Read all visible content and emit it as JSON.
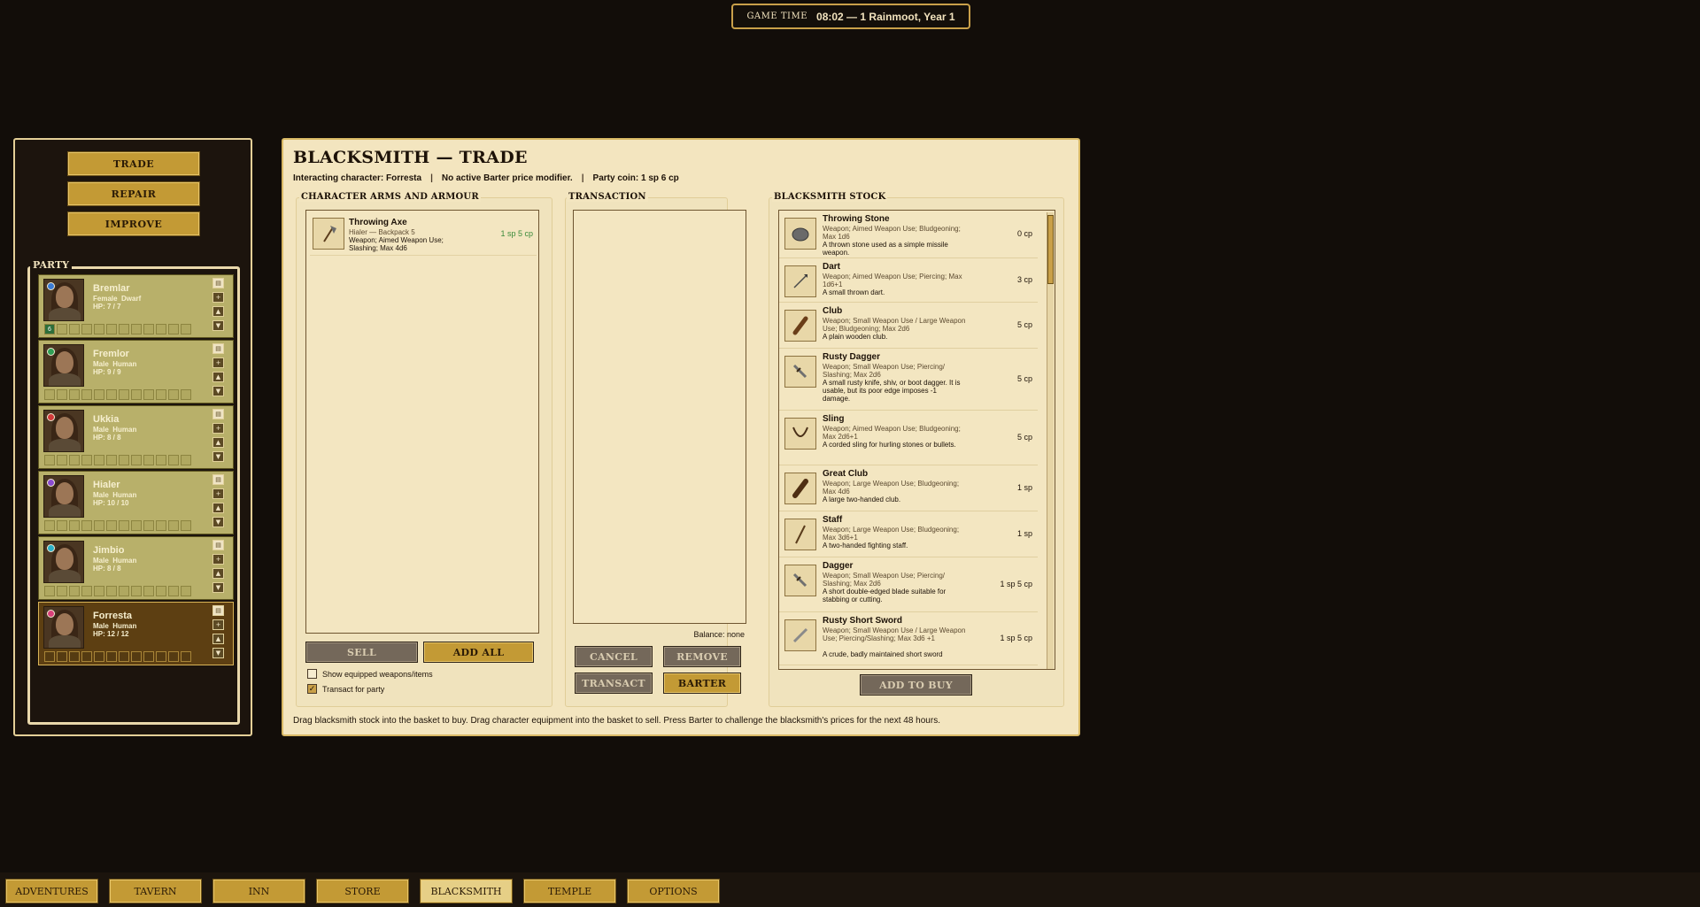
{
  "game_time": {
    "label": "GAME TIME",
    "value": "08:02 — 1 Rainmoot, Year 1"
  },
  "side_actions": [
    "TRADE",
    "REPAIR",
    "IMPROVE"
  ],
  "party": {
    "label": "PARTY",
    "members": [
      {
        "name": "Bremlar",
        "gender": "Female",
        "race": "Dwarf",
        "hp": "HP:  7 / 7",
        "dot": "#3a7bd5",
        "badge": "6",
        "selected": false
      },
      {
        "name": "Fremlor",
        "gender": "Male",
        "race": "Human",
        "hp": "HP:  9 / 9",
        "dot": "#2f9e55",
        "badge": "",
        "selected": false
      },
      {
        "name": "Ukkia",
        "gender": "Male",
        "race": "Human",
        "hp": "HP:  8 / 8",
        "dot": "#d03a3a",
        "badge": "",
        "selected": false
      },
      {
        "name": "Hialer",
        "gender": "Male",
        "race": "Human",
        "hp": "HP:  10 / 10",
        "dot": "#8a4bd0",
        "badge": "",
        "selected": false
      },
      {
        "name": "Jimbio",
        "gender": "Male",
        "race": "Human",
        "hp": "HP:  8 / 8",
        "dot": "#2ab0c8",
        "badge": "",
        "selected": false
      },
      {
        "name": "Forresta",
        "gender": "Male",
        "race": "Human",
        "hp": "HP:  12 / 12",
        "dot": "#d8407a",
        "badge": "",
        "selected": true
      }
    ]
  },
  "main": {
    "title": "BLACKSMITH — TRADE",
    "interacting": "Interacting character: Forresta",
    "barter_status": "No active Barter price modifier.",
    "party_coin": "Party coin: 1 sp 6 cp",
    "footer": "Drag blacksmith stock into the basket to buy. Drag character equipment into the basket to sell. Press Barter to challenge the blacksmith's prices for the next 48 hours."
  },
  "character": {
    "heading": "CHARACTER ARMS AND ARMOUR",
    "items": [
      {
        "name": "Throwing Axe",
        "owner": "Hialer — Backpack 5",
        "type": "Weapon; Aimed Weapon Use; Slashing; Max 4d6",
        "price": "1 sp 5 cp",
        "icon": "axe-icon"
      }
    ],
    "sell_label": "SELL",
    "add_all_label": "ADD ALL",
    "show_equipped_label": "Show equipped weapons/items",
    "transact_party_label": "Transact for party"
  },
  "transaction": {
    "heading": "TRANSACTION",
    "balance": "Balance: none",
    "cancel_label": "CANCEL",
    "remove_label": "REMOVE",
    "transact_label": "TRANSACT",
    "barter_label": "BARTER"
  },
  "stock": {
    "heading": "BLACKSMITH STOCK",
    "add_to_buy_label": "ADD TO BUY",
    "items": [
      {
        "name": "Throwing Stone",
        "type": "Weapon; Aimed Weapon Use; Bludgeoning; Max 1d6",
        "desc": "A thrown stone used as a simple missile weapon.",
        "price": "0 cp",
        "icon": "stone-icon"
      },
      {
        "name": "Dart",
        "type": "Weapon; Aimed Weapon Use; Piercing; Max 1d6+1",
        "desc": "A small thrown dart.",
        "price": "3 cp",
        "icon": "dart-icon"
      },
      {
        "name": "Club",
        "type": "Weapon; Small Weapon Use / Large Weapon Use; Bludgeoning; Max 2d6",
        "desc": "A plain wooden club.",
        "price": "5 cp",
        "icon": "club-icon"
      },
      {
        "name": "Rusty Dagger",
        "type": "Weapon; Small Weapon Use; Piercing/ Slashing; Max 2d6",
        "desc": "A small rusty knife, shiv, or boot dagger. It is usable, but its poor edge imposes -1 damage.",
        "price": "5 cp",
        "icon": "dagger-icon"
      },
      {
        "name": "Sling",
        "type": "Weapon; Aimed Weapon Use; Bludgeoning; Max 2d6+1",
        "desc": "A corded sling for hurling stones or bullets.",
        "price": "5 cp",
        "icon": "sling-icon"
      },
      {
        "name": "Great Club",
        "type": "Weapon; Large Weapon Use; Bludgeoning; Max 4d6",
        "desc": "A large two-handed club.",
        "price": "1 sp",
        "icon": "great-club-icon"
      },
      {
        "name": "Staff",
        "type": "Weapon; Large Weapon Use; Bludgeoning; Max 3d6+1",
        "desc": "A two-handed fighting staff.",
        "price": "1 sp",
        "icon": "staff-icon"
      },
      {
        "name": "Dagger",
        "type": "Weapon; Small Weapon Use; Piercing/ Slashing; Max 2d6",
        "desc": "A short double-edged blade suitable for stabbing or cutting.",
        "price": "1 sp 5 cp",
        "icon": "dagger-icon"
      },
      {
        "name": "Rusty Short Sword",
        "type": "Weapon; Small Weapon Use / Large Weapon Use; Piercing/Slashing; Max 3d6 +1",
        "desc": "A crude, badly maintained short sword",
        "price": "1 sp 5 cp",
        "icon": "sword-icon"
      }
    ]
  },
  "nav_tabs": [
    "ADVENTURES",
    "TAVERN",
    "INN",
    "STORE",
    "BLACKSMITH",
    "TEMPLE",
    "OPTIONS"
  ],
  "active_tab": "BLACKSMITH"
}
